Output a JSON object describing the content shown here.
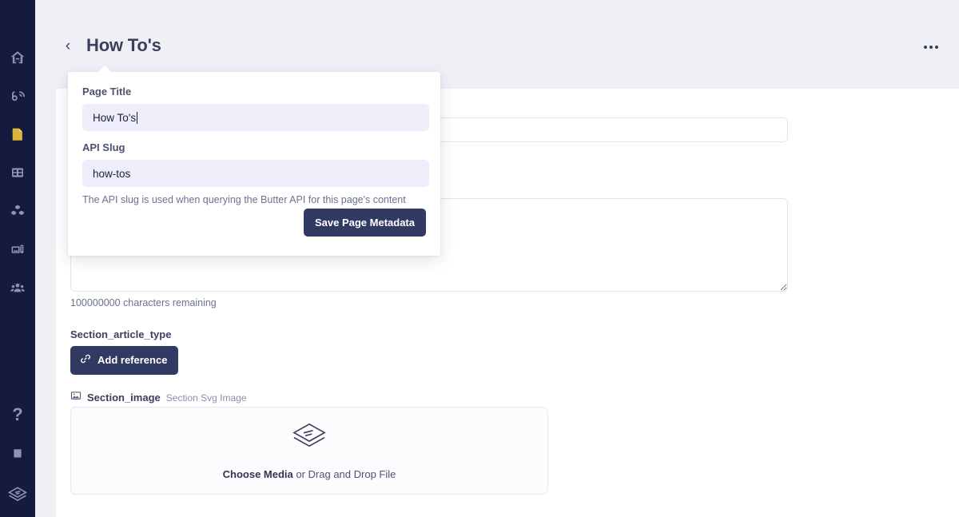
{
  "theme": {
    "sidebar_bg": "#141b3c",
    "page_bg": "#eff0f6",
    "card_bg": "#ffffff",
    "accent_dark": "#313a63",
    "accent_gold": "#d9b53c",
    "icon_muted": "#8e95b0",
    "field_fill": "#edeefa",
    "text_primary": "#3b3f5e",
    "text_muted": "#6a7290"
  },
  "sidebar": {
    "items": [
      {
        "icon": "home-icon",
        "active": false
      },
      {
        "icon": "blog-icon",
        "active": false
      },
      {
        "icon": "pages-icon",
        "active": true
      },
      {
        "icon": "collections-icon",
        "active": false
      },
      {
        "icon": "components-icon",
        "active": false
      },
      {
        "icon": "media-icon",
        "active": false
      },
      {
        "icon": "team-icon",
        "active": false
      }
    ],
    "bottom_items": [
      {
        "icon": "help-icon",
        "label": "?"
      },
      {
        "icon": "docs-icon",
        "label": ""
      },
      {
        "icon": "butter-logo-icon",
        "label": ""
      }
    ]
  },
  "header": {
    "back_label": "‹",
    "title": "How To's",
    "menu_icon": "kebab-menu-icon"
  },
  "popover": {
    "page_title_label": "Page Title",
    "page_title_value": "How To's",
    "api_slug_label": "API Slug",
    "api_slug_value": "how-tos",
    "help_text": "The API slug is used when querying the Butter API for this page's content",
    "save_label": "Save Page Metadata"
  },
  "main": {
    "hidden_field_value": "",
    "hidden_field_placeholder": "",
    "hidden_textarea_value": "",
    "hidden_textarea_placeholder": "",
    "char_count": "100000000 characters remaining",
    "article_type": {
      "label": "Section_article_type",
      "button_label": "Add reference",
      "button_icon": "link-icon"
    },
    "section_image": {
      "icon": "image-icon",
      "label": "Section_image",
      "sub_label": "Section Svg Image",
      "dropzone_icon": "stack-icon",
      "dropzone_cta": "Choose Media",
      "dropzone_rest": " or Drag and Drop File"
    }
  }
}
